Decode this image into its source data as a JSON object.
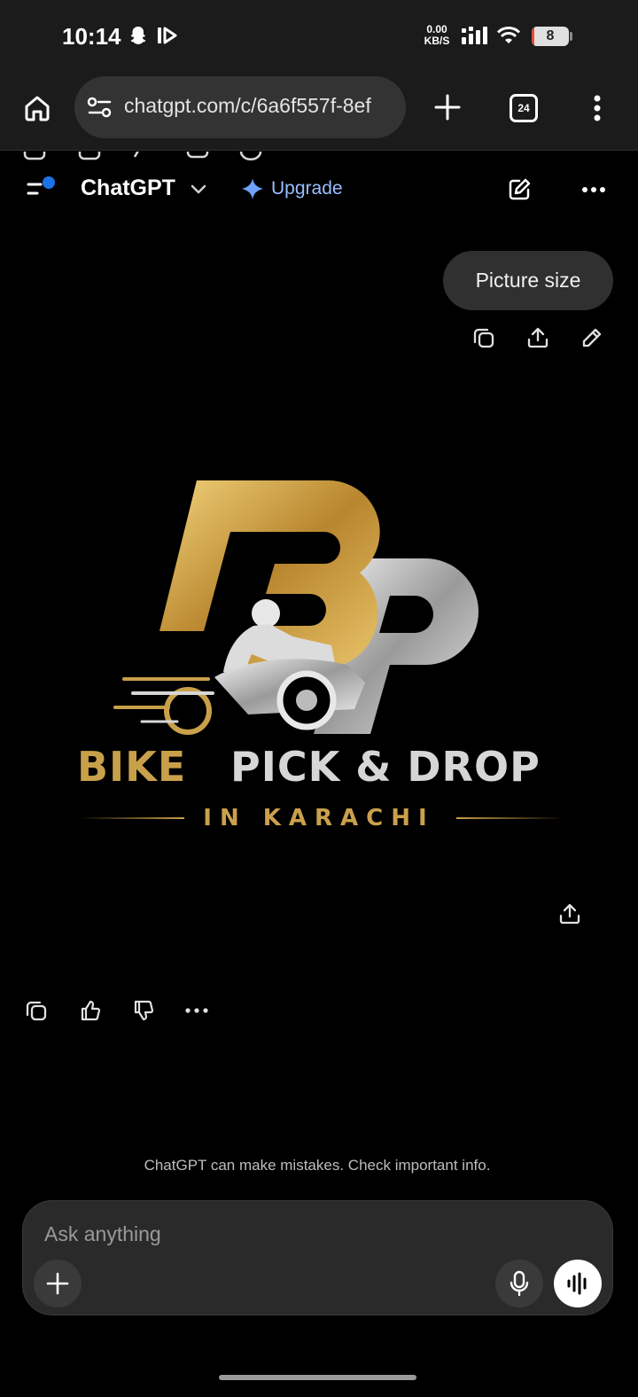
{
  "status_bar": {
    "time": "10:14",
    "net_speed_value": "0.00",
    "net_speed_unit": "KB/S",
    "battery_level": "8",
    "battery_fraction": 0.08
  },
  "browser": {
    "url": "chatgpt.com/c/6a6f557f-8ef",
    "tab_count": "24"
  },
  "header": {
    "title": "ChatGPT",
    "upgrade_label": "Upgrade"
  },
  "conversation": {
    "user_message": "Picture size"
  },
  "generated_image": {
    "brand_word_1": "BIKE",
    "brand_word_2": "PICK & DROP",
    "subtitle": "IN KARACHI"
  },
  "footer": {
    "disclaimer": "ChatGPT can make mistakes. Check important info."
  },
  "composer": {
    "placeholder": "Ask anything"
  },
  "colors": {
    "gold": "#c9a04a",
    "silver": "#d6d6d6",
    "upgrade_blue": "#99bfff",
    "accent_dot": "#1a73e8"
  }
}
